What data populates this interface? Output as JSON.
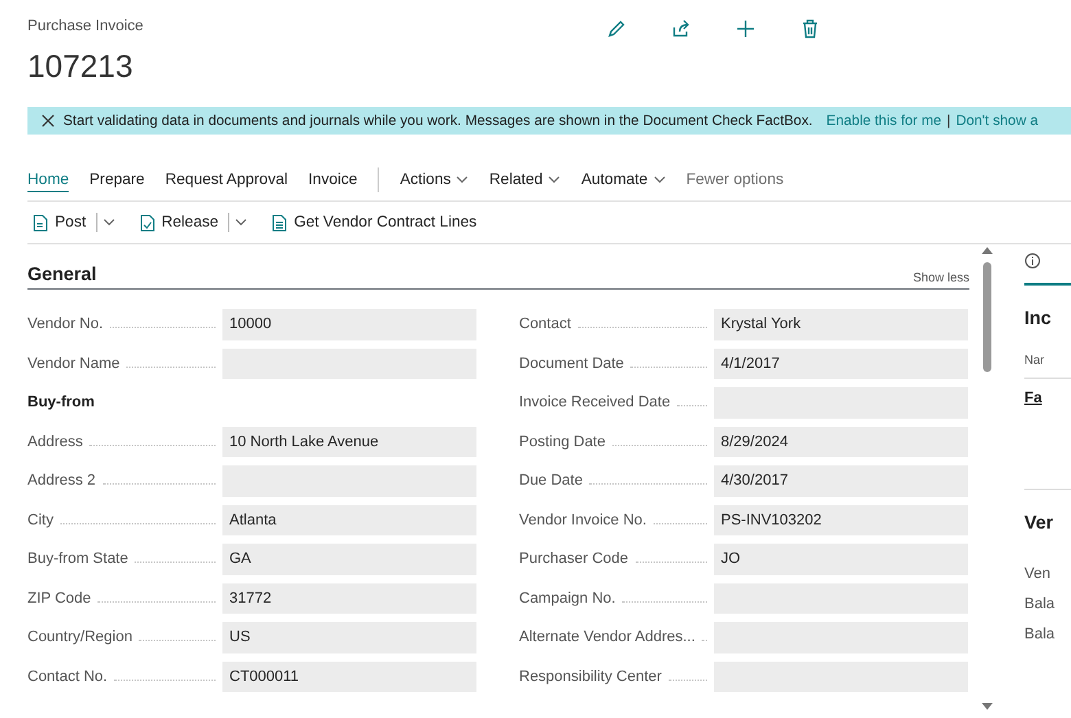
{
  "header": {
    "caption": "Purchase Invoice",
    "number": "107213"
  },
  "banner": {
    "message": "Start validating data in documents and journals while you work. Messages are shown in the Document Check FactBox.",
    "links": [
      "Enable this for me",
      "Don't show a"
    ],
    "separator": "|"
  },
  "tabs": [
    {
      "label": "Home",
      "selected": true,
      "kind": "tab"
    },
    {
      "label": "Prepare",
      "selected": false,
      "kind": "tab"
    },
    {
      "label": "Request Approval",
      "selected": false,
      "kind": "tab"
    },
    {
      "label": "Invoice",
      "selected": false,
      "kind": "tab"
    },
    {
      "label": "Actions",
      "selected": false,
      "kind": "menu"
    },
    {
      "label": "Related",
      "selected": false,
      "kind": "menu"
    },
    {
      "label": "Automate",
      "selected": false,
      "kind": "menu"
    },
    {
      "label": "Fewer options",
      "selected": false,
      "kind": "muted"
    }
  ],
  "actions": [
    {
      "label": "Post",
      "kind": "split"
    },
    {
      "label": "Release",
      "kind": "split"
    },
    {
      "label": "Get Vendor Contract Lines",
      "kind": "plain"
    }
  ],
  "section": {
    "title": "General",
    "toggle": "Show less"
  },
  "left_fields": [
    {
      "kind": "field",
      "label": "Vendor No.",
      "value": "10000"
    },
    {
      "kind": "field",
      "label": "Vendor Name"
    },
    {
      "kind": "heading",
      "label": "Buy-from"
    },
    {
      "kind": "field",
      "label": "Address",
      "value": "10 North Lake Avenue"
    },
    {
      "kind": "field",
      "label": "Address 2"
    },
    {
      "kind": "field",
      "label": "City",
      "value": "Atlanta"
    },
    {
      "kind": "field",
      "label": "Buy-from State",
      "value": "GA"
    },
    {
      "kind": "field",
      "label": "ZIP Code",
      "value": "31772"
    },
    {
      "kind": "field",
      "label": "Country/Region",
      "value": "US"
    },
    {
      "kind": "field",
      "label": "Contact No.",
      "value": "CT000011"
    }
  ],
  "right_fields": [
    {
      "kind": "field",
      "label": "Contact",
      "value": "Krystal York"
    },
    {
      "kind": "field",
      "label": "Document Date",
      "value": "4/1/2017"
    },
    {
      "kind": "field",
      "label": "Invoice Received Date"
    },
    {
      "kind": "field",
      "label": "Posting Date",
      "value": "8/29/2024"
    },
    {
      "kind": "field",
      "label": "Due Date",
      "value": "4/30/2017"
    },
    {
      "kind": "field",
      "label": "Vendor Invoice No.",
      "value": "PS-INV103202"
    },
    {
      "kind": "field",
      "label": "Purchaser Code",
      "value": "JO"
    },
    {
      "kind": "field",
      "label": "Campaign No."
    },
    {
      "kind": "field",
      "label": "Alternate Vendor Addres..."
    },
    {
      "kind": "field",
      "label": "Responsibility Center"
    }
  ],
  "factbox": {
    "heading_1": "Inc",
    "column": "Nar",
    "row_link": "Fa",
    "heading_2": "Ver",
    "labels": [
      "Ven",
      "Bala",
      "Bala"
    ]
  }
}
